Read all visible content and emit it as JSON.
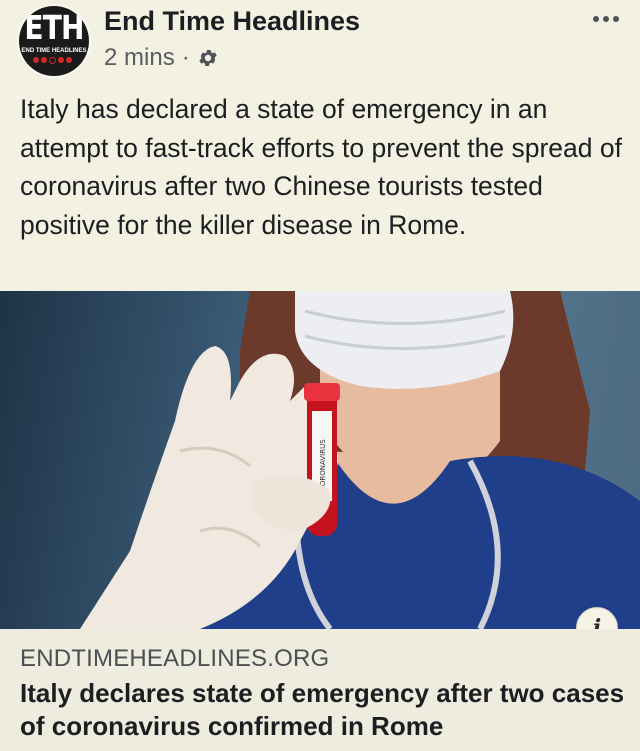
{
  "post": {
    "avatar": {
      "logo_text": "ETH",
      "logo_subtext": "END TIME HEADLINES"
    },
    "page_name": "End Time Headlines",
    "timestamp": "2 mins",
    "separator": "·",
    "audience_icon": "gear-icon",
    "more_icon": "ellipsis-icon",
    "text": "Italy has declared a state of emergency in an attempt to fast-track efforts to prevent the spread of coronavirus after two Chinese tourists tested positive for the killer disease in Rome.",
    "image": {
      "description_icon": "photo",
      "tube_label": "CORONAVIRUS"
    },
    "info_icon": "info-icon",
    "link": {
      "domain": "ENDTIMEHEADLINES.ORG",
      "title": "Italy declares state of emergency after two cases of coronavirus confirmed in Rome"
    }
  },
  "colors": {
    "background": "#f3f1e1",
    "link_box": "#eeecde",
    "text": "#1c1e21",
    "muted": "#5a5c60",
    "logo_red": "#d62a2a"
  }
}
